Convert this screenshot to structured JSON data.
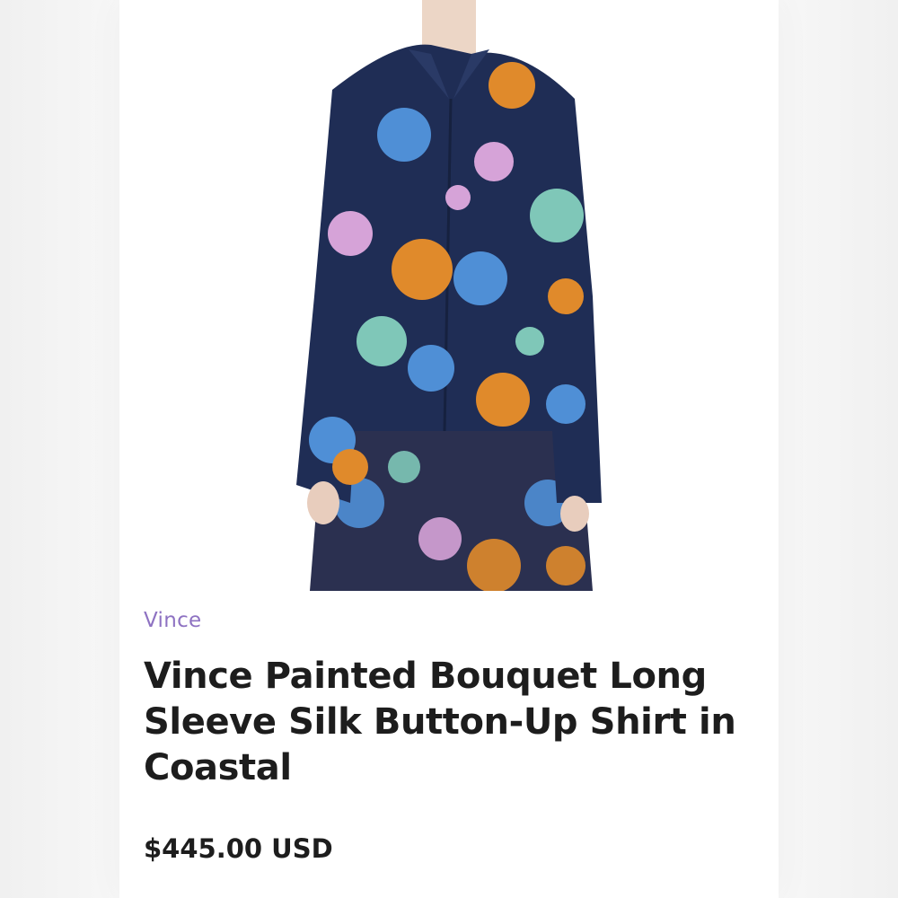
{
  "product": {
    "brand": "Vince",
    "title": "Vince Painted Bouquet Long Sleeve Silk Button-Up Shirt in Coastal",
    "price": "$445.00 USD",
    "image_description_colors": {
      "shirt_base": "#1f2d55",
      "floral_blue": "#4f8fd6",
      "floral_orange": "#e08a2b",
      "floral_pink": "#d6a3d8",
      "floral_teal": "#7fc7b8"
    }
  },
  "colors": {
    "brand_text": "#8e72c2",
    "title_text": "#1d1d1d",
    "background": "#ffffff"
  }
}
